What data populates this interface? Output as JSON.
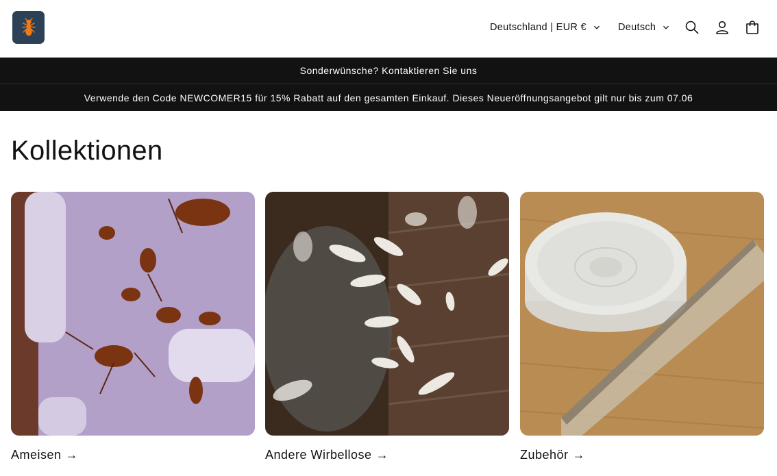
{
  "header": {
    "logo_icon": "ant-logo-icon",
    "country_selector": "Deutschland | EUR €",
    "language_selector": "Deutsch",
    "icons": [
      "search-icon",
      "account-icon",
      "cart-icon"
    ]
  },
  "announcements": [
    "Sonderwünsche? Kontaktieren Sie uns",
    "Verwende den Code NEWCOMER15 für 15% Rabatt auf den gesamten Einkauf. Dieses Neueröffnungsangebot gilt nur bis zum 07.06"
  ],
  "main": {
    "title": "Kollektionen",
    "collections": [
      {
        "label": "Ameisen",
        "arrow": "→"
      },
      {
        "label": "Andere Wirbellose",
        "arrow": "→"
      },
      {
        "label": "Zubehör",
        "arrow": "→"
      }
    ]
  },
  "colors": {
    "announcement_bg": "#121212",
    "announcement_text": "#ffffff",
    "logo_bg": "#2c4156",
    "logo_ant": "#f07a1a"
  }
}
